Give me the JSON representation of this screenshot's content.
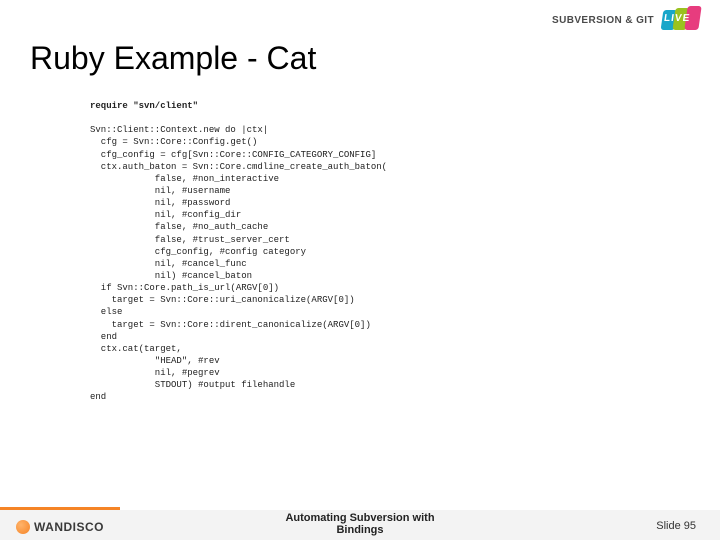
{
  "logo": {
    "svg_text": "SUBVERSION & GIT",
    "live_text": "LIVE"
  },
  "title": "Ruby Example - Cat",
  "code": {
    "require_line": "require \"svn/client\"",
    "body": "Svn::Client::Context.new do |ctx|\n  cfg = Svn::Core::Config.get()\n  cfg_config = cfg[Svn::Core::CONFIG_CATEGORY_CONFIG]\n  ctx.auth_baton = Svn::Core.cmdline_create_auth_baton(\n            false, #non_interactive\n            nil, #username\n            nil, #password\n            nil, #config_dir\n            false, #no_auth_cache\n            false, #trust_server_cert\n            cfg_config, #config category\n            nil, #cancel_func\n            nil) #cancel_baton\n  if Svn::Core.path_is_url(ARGV[0])\n    target = Svn::Core::uri_canonicalize(ARGV[0])\n  else\n    target = Svn::Core::dirent_canonicalize(ARGV[0])\n  end\n  ctx.cat(target,\n            \"HEAD\", #rev\n            nil, #pegrev\n            STDOUT) #output filehandle\nend"
  },
  "footer": {
    "brand": "WANDISCO",
    "center_line1": "Automating Subversion with",
    "center_line2": "Bindings",
    "slide_label": "Slide 95"
  }
}
